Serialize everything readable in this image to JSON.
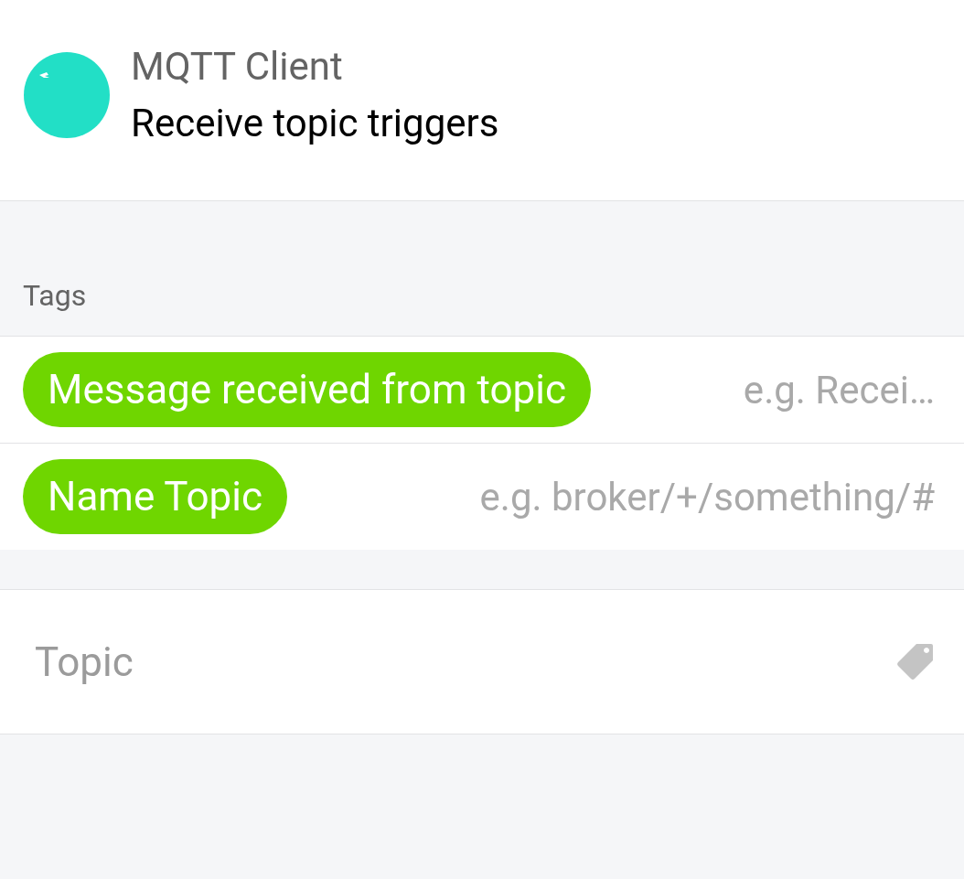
{
  "header": {
    "title": "MQTT Client",
    "subtitle": "Receive topic triggers"
  },
  "tags_section": {
    "label": "Tags",
    "tags": [
      {
        "label": "Message received from topic",
        "placeholder": "e.g. Recei…"
      },
      {
        "label": "Name Topic",
        "placeholder": "e.g. broker/+/something/#"
      }
    ]
  },
  "topic_field": {
    "placeholder": "Topic"
  }
}
